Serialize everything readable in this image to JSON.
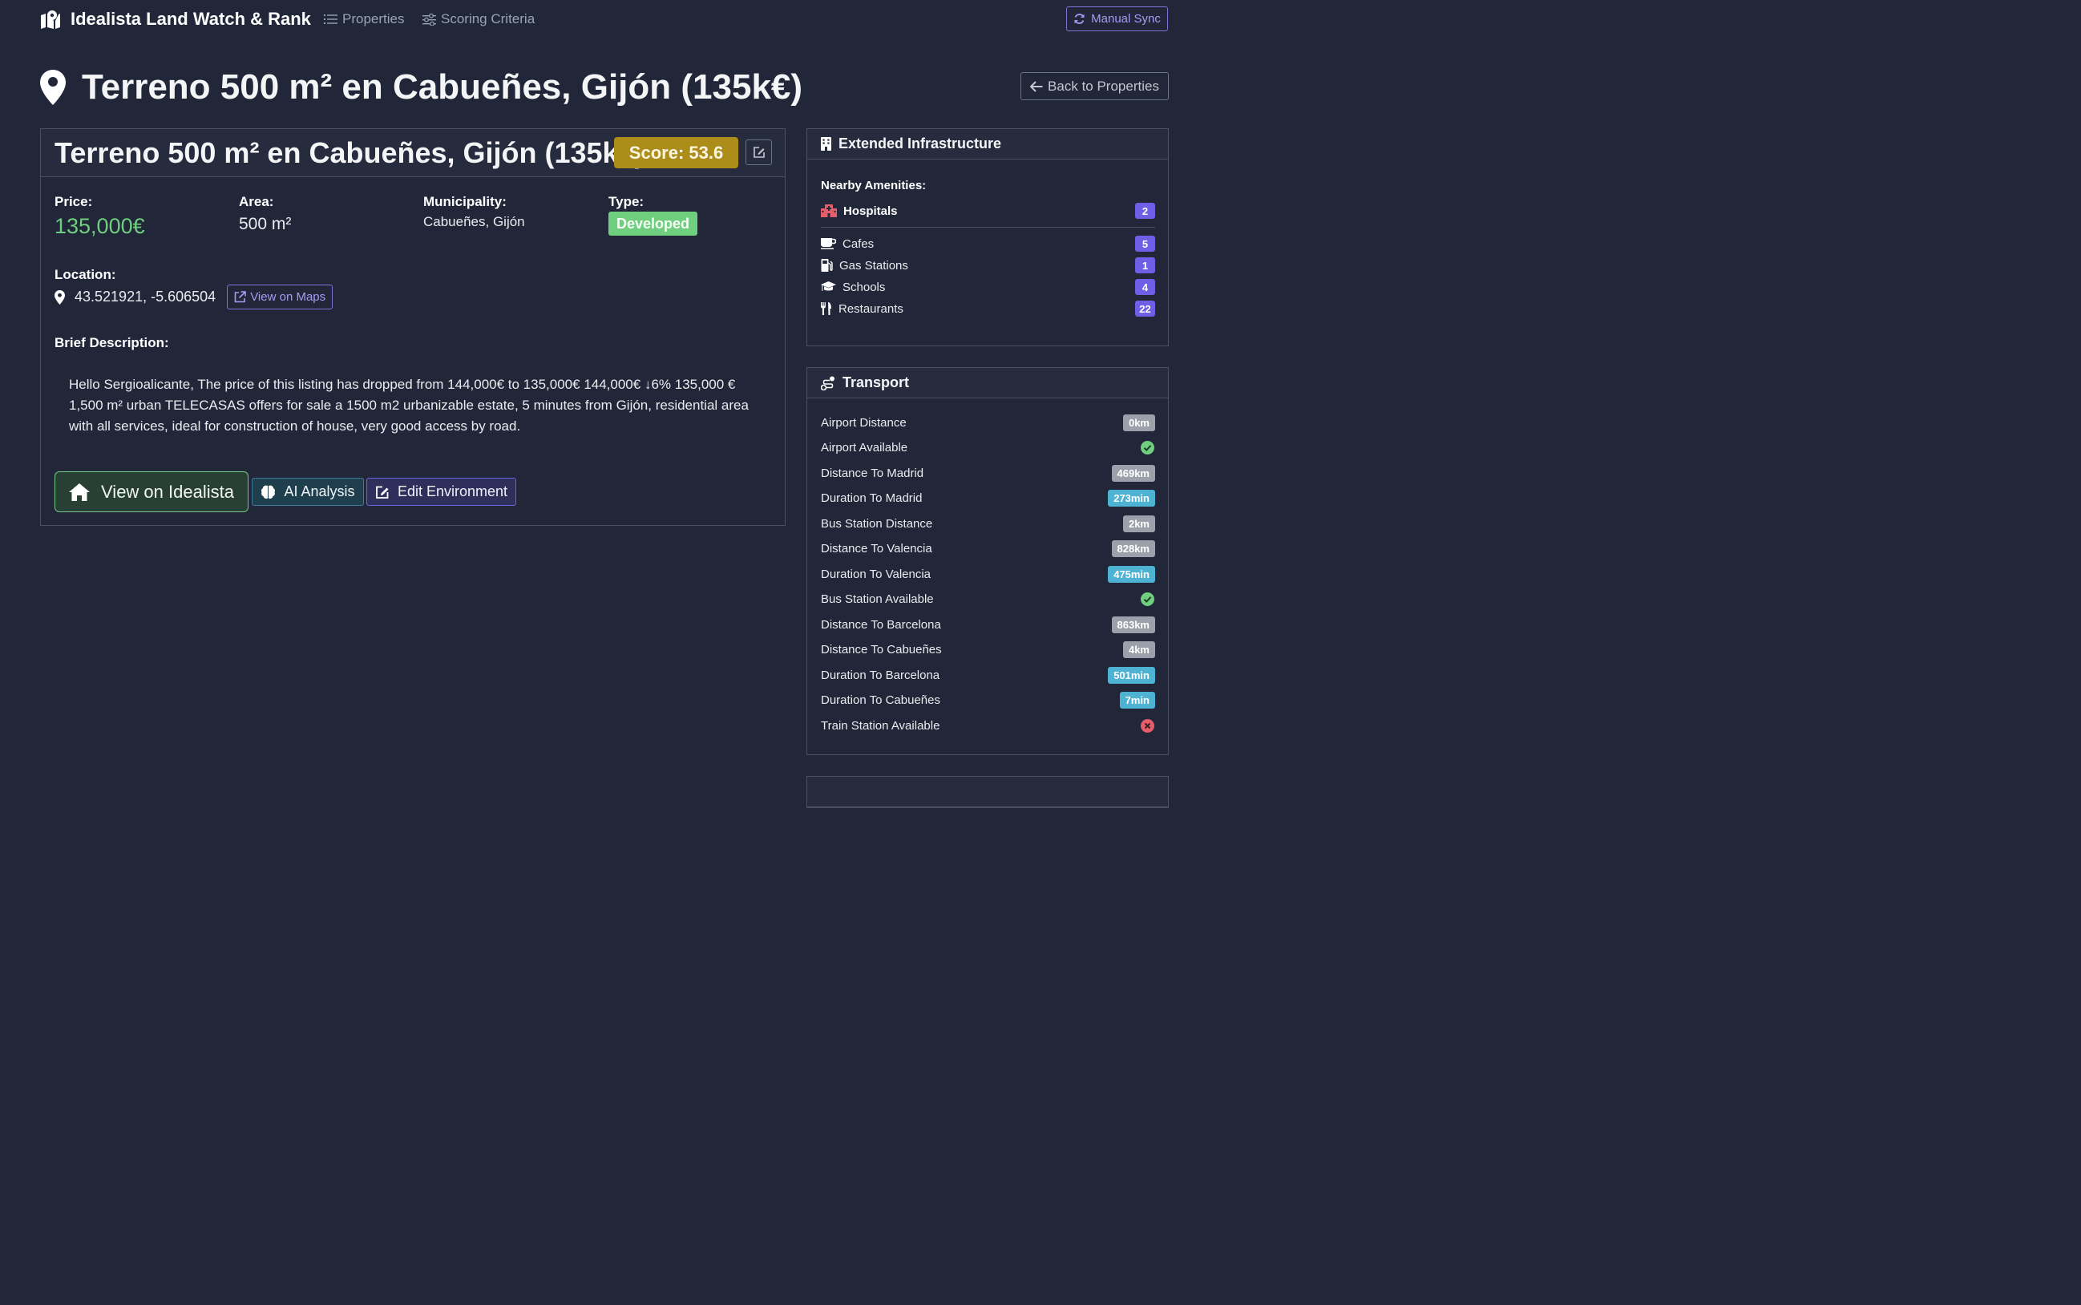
{
  "navbar": {
    "brand": "Idealista Land Watch & Rank",
    "links": [
      "Properties",
      "Scoring Criteria"
    ],
    "sync_label": "Manual Sync"
  },
  "page": {
    "title": "Terreno 500 m² en Cabueñes, Gijón (135k€)",
    "back_label": "Back to Properties"
  },
  "property": {
    "title": "Terreno 500 m² en Cabueñes, Gijón (135k€)",
    "score": "Score: 53.6",
    "price_label": "Price:",
    "price": "135,000€",
    "area_label": "Area:",
    "area": "500 m²",
    "municipality_label": "Municipality:",
    "municipality": "Cabueñes, Gijón",
    "type_label": "Type:",
    "type": "Developed",
    "location_label": "Location:",
    "coordinates": "43.521921, -5.606504",
    "maps_label": "View on Maps",
    "description_label": "Brief Description:",
    "description": "Hello Sergioalicante, The price of this listing has dropped from 144,000€ to 135,000€ 144,000€ ↓6% 135,000 € 1,500 m² urban TELECASAS offers for sale a 1500 m2 urbanizable estate, 5 minutes from Gijón, residential area with all services, ideal for construction of house, very good access by road."
  },
  "actions": {
    "idealista": "View on Idealista",
    "ai": "AI Analysis",
    "env": "Edit Environment"
  },
  "infrastructure": {
    "title": "Extended Infrastructure",
    "amenities_label": "Nearby Amenities:",
    "highlight": {
      "label": "Hospitals",
      "count": "2",
      "icon": "hospital-icon"
    },
    "items": [
      {
        "label": "Cafes",
        "count": "5",
        "icon": "coffee-icon"
      },
      {
        "label": "Gas Stations",
        "count": "1",
        "icon": "gas-pump-icon"
      },
      {
        "label": "Schools",
        "count": "4",
        "icon": "graduation-cap-icon"
      },
      {
        "label": "Restaurants",
        "count": "22",
        "icon": "utensils-icon"
      }
    ]
  },
  "transport": {
    "title": "Transport",
    "rows": [
      {
        "label": "Airport Distance",
        "value": "0km",
        "kind": "grey"
      },
      {
        "label": "Airport Available",
        "value": "",
        "kind": "yes"
      },
      {
        "label": "Distance To Madrid",
        "value": "469km",
        "kind": "grey"
      },
      {
        "label": "Duration To Madrid",
        "value": "273min",
        "kind": "cyan"
      },
      {
        "label": "Bus Station Distance",
        "value": "2km",
        "kind": "grey"
      },
      {
        "label": "Distance To Valencia",
        "value": "828km",
        "kind": "grey"
      },
      {
        "label": "Duration To Valencia",
        "value": "475min",
        "kind": "cyan"
      },
      {
        "label": "Bus Station Available",
        "value": "",
        "kind": "yes"
      },
      {
        "label": "Distance To Barcelona",
        "value": "863km",
        "kind": "grey"
      },
      {
        "label": "Distance To Cabueñes",
        "value": "4km",
        "kind": "grey"
      },
      {
        "label": "Duration To Barcelona",
        "value": "501min",
        "kind": "cyan"
      },
      {
        "label": "Duration To Cabueñes",
        "value": "7min",
        "kind": "cyan"
      },
      {
        "label": "Train Station Available",
        "value": "",
        "kind": "no"
      }
    ]
  },
  "colors": {
    "background": "#212738",
    "accent_purple": "#6e5fe6",
    "success_green": "#6fcf7f",
    "score_gold": "#ad8d1a",
    "info_cyan": "#4eb3d3"
  }
}
